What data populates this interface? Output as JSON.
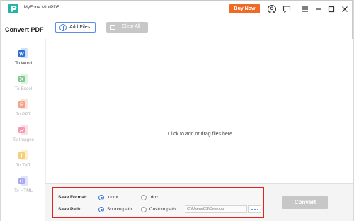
{
  "app": {
    "title": "iMyFone MintPDF",
    "buy_label": "Buy Now",
    "brand_color": "#23b3a9",
    "accent_color": "#f06a23"
  },
  "titlebar": {
    "icons": [
      "account-icon",
      "feedback-icon",
      "menu-icon",
      "minimize-icon",
      "maximize-icon",
      "close-icon"
    ]
  },
  "sidebar": {
    "title": "Convert PDF",
    "items": [
      {
        "label": "To Word",
        "icon": "word-icon",
        "color": "#2b6fd6",
        "active": true
      },
      {
        "label": "To Excel",
        "icon": "excel-icon",
        "color": "#7fc98f",
        "active": false
      },
      {
        "label": "To PPT",
        "icon": "ppt-icon",
        "color": "#f0a58c",
        "active": false
      },
      {
        "label": "To Images",
        "icon": "images-icon",
        "color": "#f09bb0",
        "active": false
      },
      {
        "label": "To TXT",
        "icon": "txt-icon",
        "color": "#f3cf7a",
        "active": false
      },
      {
        "label": "To HTML",
        "icon": "html-icon",
        "color": "#a7a8f0",
        "active": false
      }
    ]
  },
  "toolbar": {
    "add_label": "Add Files",
    "clear_label": "Clear All"
  },
  "dropzone": {
    "text": "Click to add or drag files here"
  },
  "settings": {
    "format_label": "Save Format:",
    "format_options": [
      ".docx",
      ".doc"
    ],
    "format_selected": ".docx",
    "path_label": "Save Path:",
    "path_options": [
      "Source path",
      "Custom path"
    ],
    "path_selected": "Source path",
    "custom_path": "C:\\Users\\CS\\Desktop"
  },
  "convert_label": "Convert"
}
